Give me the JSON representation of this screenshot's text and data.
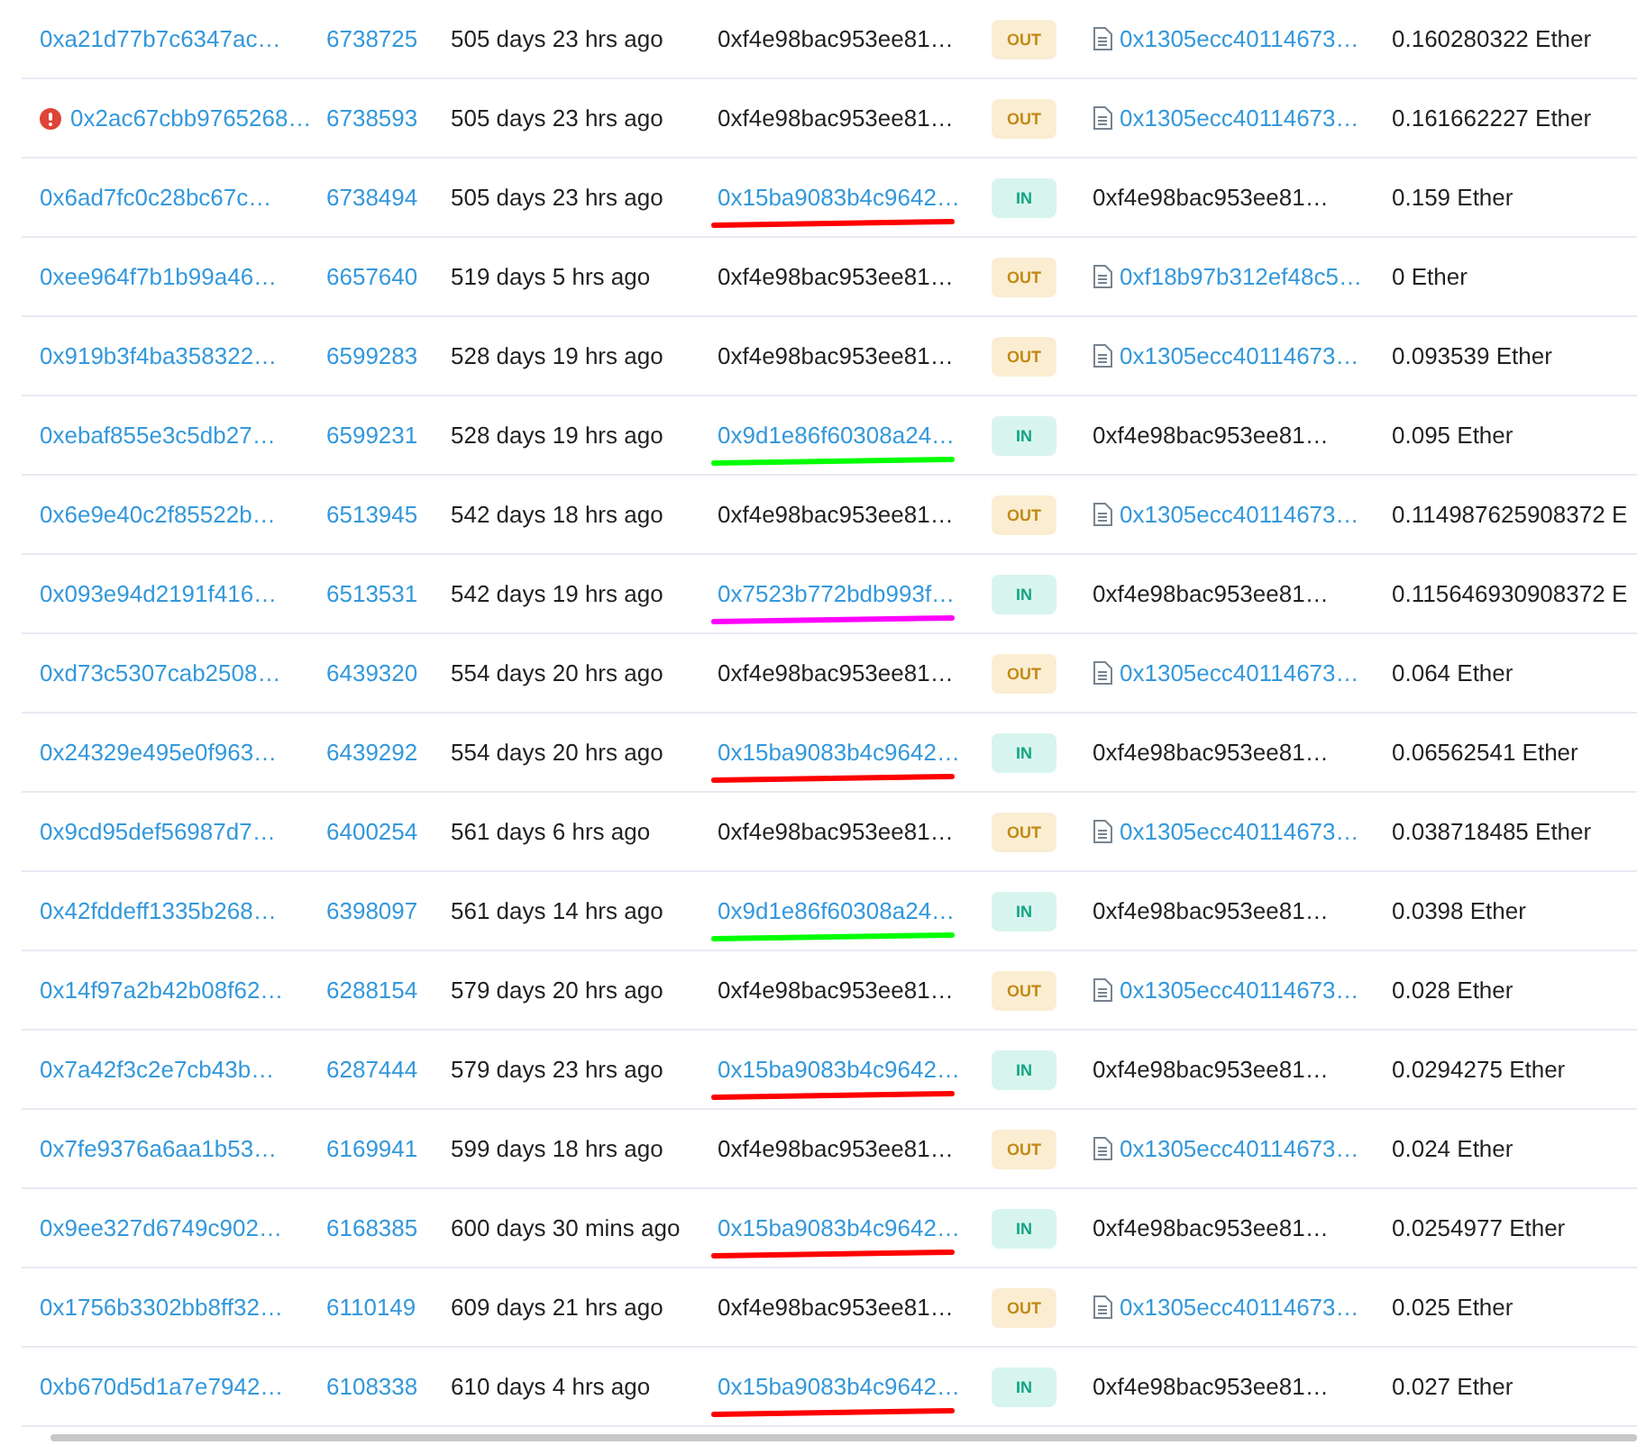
{
  "rows": [
    {
      "hash": "0xa21d77b7c6347ac…",
      "error": false,
      "block": "6738725",
      "age": "505 days 23 hrs ago",
      "from": "0xf4e98bac953ee81…",
      "from_link": false,
      "badge": "OUT",
      "kind": "out",
      "to": "0x1305ecc40114673…",
      "to_contract": true,
      "value": "0.160280322 Ether"
    },
    {
      "hash": "0x2ac67cbb9765268…",
      "error": true,
      "block": "6738593",
      "age": "505 days 23 hrs ago",
      "from": "0xf4e98bac953ee81…",
      "from_link": false,
      "badge": "OUT",
      "kind": "out",
      "to": "0x1305ecc40114673…",
      "to_contract": true,
      "value": "0.161662227 Ether"
    },
    {
      "hash": "0x6ad7fc0c28bc67c…",
      "error": false,
      "block": "6738494",
      "age": "505 days 23 hrs ago",
      "from": "0x15ba9083b4c9642…",
      "from_link": true,
      "underline": {
        "color": "#ff0000"
      },
      "badge": "IN",
      "kind": "in",
      "to": "0xf4e98bac953ee81…",
      "to_contract": false,
      "value": "0.159 Ether"
    },
    {
      "hash": "0xee964f7b1b99a46…",
      "error": false,
      "block": "6657640",
      "age": "519 days 5 hrs ago",
      "from": "0xf4e98bac953ee81…",
      "from_link": false,
      "badge": "OUT",
      "kind": "out",
      "to": "0xf18b97b312ef48c5…",
      "to_contract": true,
      "value": "0 Ether"
    },
    {
      "hash": "0x919b3f4ba358322…",
      "error": false,
      "block": "6599283",
      "age": "528 days 19 hrs ago",
      "from": "0xf4e98bac953ee81…",
      "from_link": false,
      "badge": "OUT",
      "kind": "out",
      "to": "0x1305ecc40114673…",
      "to_contract": true,
      "value": "0.093539 Ether"
    },
    {
      "hash": "0xebaf855e3c5db27…",
      "error": false,
      "block": "6599231",
      "age": "528 days 19 hrs ago",
      "from": "0x9d1e86f60308a24…",
      "from_link": true,
      "underline": {
        "color": "#00ff00"
      },
      "badge": "IN",
      "kind": "in",
      "to": "0xf4e98bac953ee81…",
      "to_contract": false,
      "value": "0.095 Ether"
    },
    {
      "hash": "0x6e9e40c2f85522b…",
      "error": false,
      "block": "6513945",
      "age": "542 days 18 hrs ago",
      "from": "0xf4e98bac953ee81…",
      "from_link": false,
      "badge": "OUT",
      "kind": "out",
      "to": "0x1305ecc40114673…",
      "to_contract": true,
      "value": "0.114987625908372 E"
    },
    {
      "hash": "0x093e94d2191f416…",
      "error": false,
      "block": "6513531",
      "age": "542 days 19 hrs ago",
      "from": "0x7523b772bdb993f…",
      "from_link": true,
      "underline": {
        "color": "#ff00ff"
      },
      "badge": "IN",
      "kind": "in",
      "to": "0xf4e98bac953ee81…",
      "to_contract": false,
      "value": "0.115646930908372 E"
    },
    {
      "hash": "0xd73c5307cab2508…",
      "error": false,
      "block": "6439320",
      "age": "554 days 20 hrs ago",
      "from": "0xf4e98bac953ee81…",
      "from_link": false,
      "badge": "OUT",
      "kind": "out",
      "to": "0x1305ecc40114673…",
      "to_contract": true,
      "value": "0.064 Ether"
    },
    {
      "hash": "0x24329e495e0f963…",
      "error": false,
      "block": "6439292",
      "age": "554 days 20 hrs ago",
      "from": "0x15ba9083b4c9642…",
      "from_link": true,
      "underline": {
        "color": "#ff0000"
      },
      "badge": "IN",
      "kind": "in",
      "to": "0xf4e98bac953ee81…",
      "to_contract": false,
      "value": "0.06562541 Ether"
    },
    {
      "hash": "0x9cd95def56987d7…",
      "error": false,
      "block": "6400254",
      "age": "561 days 6 hrs ago",
      "from": "0xf4e98bac953ee81…",
      "from_link": false,
      "badge": "OUT",
      "kind": "out",
      "to": "0x1305ecc40114673…",
      "to_contract": true,
      "value": "0.038718485 Ether"
    },
    {
      "hash": "0x42fddeff1335b268…",
      "error": false,
      "block": "6398097",
      "age": "561 days 14 hrs ago",
      "from": "0x9d1e86f60308a24…",
      "from_link": true,
      "underline": {
        "color": "#00ff00"
      },
      "badge": "IN",
      "kind": "in",
      "to": "0xf4e98bac953ee81…",
      "to_contract": false,
      "value": "0.0398 Ether"
    },
    {
      "hash": "0x14f97a2b42b08f62…",
      "error": false,
      "block": "6288154",
      "age": "579 days 20 hrs ago",
      "from": "0xf4e98bac953ee81…",
      "from_link": false,
      "badge": "OUT",
      "kind": "out",
      "to": "0x1305ecc40114673…",
      "to_contract": true,
      "value": "0.028 Ether"
    },
    {
      "hash": "0x7a42f3c2e7cb43b…",
      "error": false,
      "block": "6287444",
      "age": "579 days 23 hrs ago",
      "from": "0x15ba9083b4c9642…",
      "from_link": true,
      "underline": {
        "color": "#ff0000"
      },
      "badge": "IN",
      "kind": "in",
      "to": "0xf4e98bac953ee81…",
      "to_contract": false,
      "value": "0.0294275 Ether"
    },
    {
      "hash": "0x7fe9376a6aa1b53…",
      "error": false,
      "block": "6169941",
      "age": "599 days 18 hrs ago",
      "from": "0xf4e98bac953ee81…",
      "from_link": false,
      "badge": "OUT",
      "kind": "out",
      "to": "0x1305ecc40114673…",
      "to_contract": true,
      "value": "0.024 Ether"
    },
    {
      "hash": "0x9ee327d6749c902…",
      "error": false,
      "block": "6168385",
      "age": "600 days 30 mins ago",
      "from": "0x15ba9083b4c9642…",
      "from_link": true,
      "underline": {
        "color": "#ff0000"
      },
      "badge": "IN",
      "kind": "in",
      "to": "0xf4e98bac953ee81…",
      "to_contract": false,
      "value": "0.0254977 Ether"
    },
    {
      "hash": "0x1756b3302bb8ff32…",
      "error": false,
      "block": "6110149",
      "age": "609 days 21 hrs ago",
      "from": "0xf4e98bac953ee81…",
      "from_link": false,
      "badge": "OUT",
      "kind": "out",
      "to": "0x1305ecc40114673…",
      "to_contract": true,
      "value": "0.025 Ether"
    },
    {
      "hash": "0xb670d5d1a7e7942…",
      "error": false,
      "block": "6108338",
      "age": "610 days 4 hrs ago",
      "from": "0x15ba9083b4c9642…",
      "from_link": true,
      "underline": {
        "color": "#ff0000"
      },
      "badge": "IN",
      "kind": "in",
      "to": "0xf4e98bac953ee81…",
      "to_contract": false,
      "value": "0.027 Ether"
    }
  ]
}
